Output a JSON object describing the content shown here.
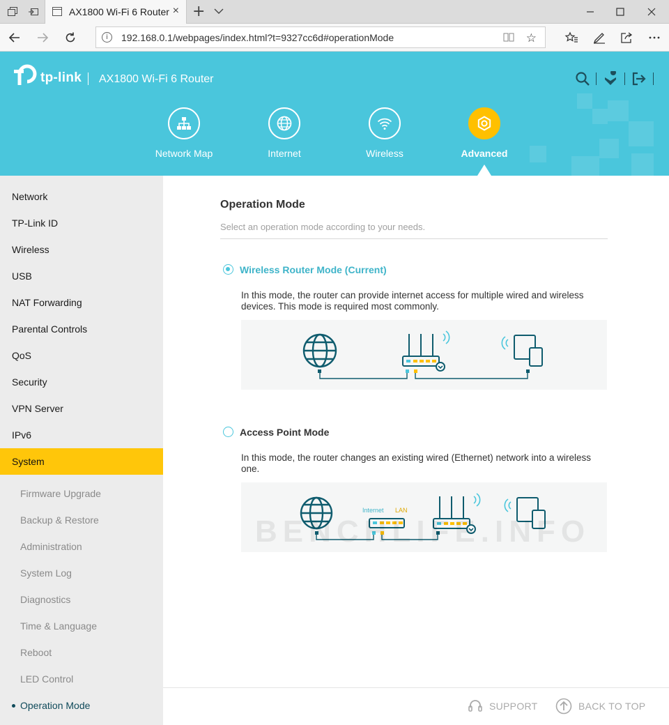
{
  "browser": {
    "tab_title": "AX1800 Wi-Fi 6 Router",
    "url": "192.168.0.1/webpages/index.html?t=9327cc6d#operationMode",
    "new_tab": "+",
    "close_tab": "×"
  },
  "header": {
    "brand": "tp-link",
    "model": "AX1800 Wi-Fi 6 Router",
    "nav": [
      {
        "label": "Network Map",
        "icon": "network-map-icon"
      },
      {
        "label": "Internet",
        "icon": "globe-icon"
      },
      {
        "label": "Wireless",
        "icon": "wifi-icon"
      },
      {
        "label": "Advanced",
        "icon": "gear-icon",
        "active": true
      }
    ]
  },
  "sidebar": {
    "items": [
      "Network",
      "TP-Link ID",
      "Wireless",
      "USB",
      "NAT Forwarding",
      "Parental Controls",
      "QoS",
      "Security",
      "VPN Server",
      "IPv6",
      "System"
    ],
    "active_item": "System",
    "sub_items": [
      "Firmware Upgrade",
      "Backup & Restore",
      "Administration",
      "System Log",
      "Diagnostics",
      "Time & Language",
      "Reboot",
      "LED Control",
      "Operation Mode"
    ],
    "current_sub": "Operation Mode"
  },
  "main": {
    "title": "Operation Mode",
    "subtitle": "Select an operation mode according to your needs.",
    "modes": [
      {
        "label": "Wireless Router Mode (Current)",
        "selected": true,
        "description": "In this mode, the router can provide internet access for multiple wired and wireless devices. This mode is required most commonly."
      },
      {
        "label": "Access Point Mode",
        "selected": false,
        "description": "In this mode, the router changes an existing wired (Ethernet) network into a wireless one.",
        "diagram_labels": {
          "internet": "Internet",
          "lan": "LAN"
        }
      }
    ]
  },
  "footer": {
    "support": "SUPPORT",
    "back_to_top": "BACK TO TOP"
  },
  "watermark": "BENCHLIFE.INFO",
  "colors": {
    "header": "#4ac6dc",
    "accent": "#ffc000",
    "sidebar_active": "#ffc60a",
    "diagram": "#0f5c6e"
  }
}
